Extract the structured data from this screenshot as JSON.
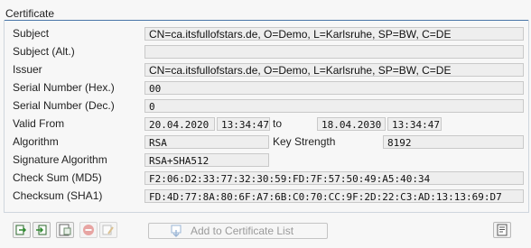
{
  "group": {
    "title": "Certificate"
  },
  "labels": {
    "subject": "Subject",
    "subject_alt": "Subject (Alt.)",
    "issuer": "Issuer",
    "serial_hex": "Serial Number (Hex.)",
    "serial_dec": "Serial Number (Dec.)",
    "valid_from": "Valid From",
    "to": "to",
    "algorithm": "Algorithm",
    "key_strength": "Key Strength",
    "signature_algorithm": "Signature Algorithm",
    "checksum_md5": "Check Sum (MD5)",
    "checksum_sha1": "Checksum (SHA1)"
  },
  "values": {
    "subject": "CN=ca.itsfullofstars.de, O=Demo, L=Karlsruhe, SP=BW, C=DE",
    "subject_alt": "",
    "issuer": "CN=ca.itsfullofstars.de, O=Demo, L=Karlsruhe, SP=BW, C=DE",
    "serial_hex": "00",
    "serial_dec": "0",
    "valid_from_date": "20.04.2020",
    "valid_from_time": "13:34:47",
    "valid_to_date": "18.04.2030",
    "valid_to_time": "13:34:47",
    "algorithm": "RSA",
    "key_strength": "8192",
    "signature_algorithm": "RSA+SHA512",
    "checksum_md5": "F2:06:D2:33:77:32:30:59:FD:7F:57:50:49:A5:40:34",
    "checksum_sha1": "FD:4D:77:8A:80:6F:A7:6B:C0:70:CC:9F:2D:22:C3:AD:13:13:69:D7"
  },
  "toolbar": {
    "add_label": "Add to Certificate List",
    "icons": [
      "import-icon",
      "export-icon",
      "display-icon",
      "remove-icon",
      "edit-icon",
      "add-to-list-icon",
      "details-icon"
    ]
  },
  "colors": {
    "accent": "#4a76a8",
    "field_bg": "#eeeeee",
    "panel_bg": "#f7f7f7"
  }
}
